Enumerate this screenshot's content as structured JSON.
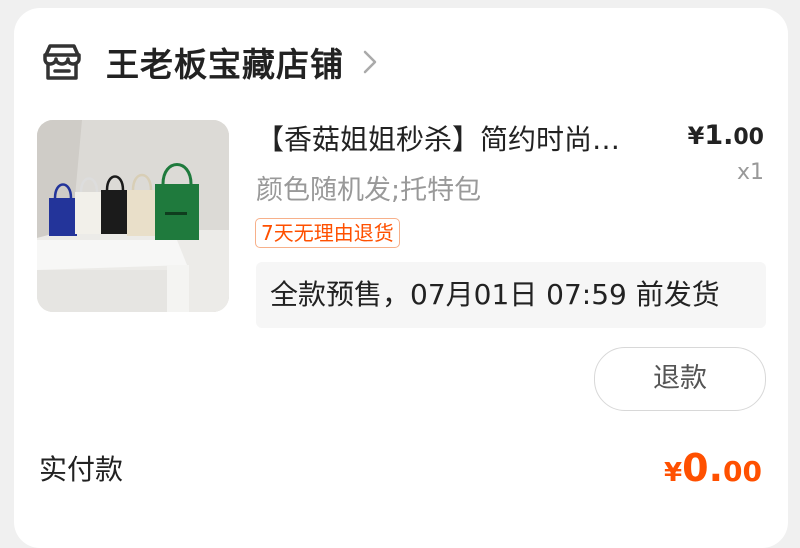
{
  "shop": {
    "icon": "store-icon",
    "name": "王老板宝藏店铺",
    "arrow_icon": "chevron-right-icon"
  },
  "item": {
    "thumbnail": "product-photo-tote-bags",
    "title": "【香菇姐姐秒杀】简约时尚…",
    "price_currency": "¥",
    "price_integer": "1.",
    "price_decimal": "00",
    "spec": "颜色随机发;托特包",
    "quantity": "x1",
    "service_tag": "7天无理由退货",
    "presale_note": "全款预售，07月01日 07:59 前发货"
  },
  "actions": {
    "refund_label": "退款"
  },
  "payment": {
    "label": "实付款",
    "currency": "¥",
    "amount_integer": "0.",
    "amount_decimal": "00"
  },
  "colors": {
    "accent": "#ff5000",
    "background": "#f0f0f0",
    "card": "#ffffff",
    "muted": "#999999"
  }
}
